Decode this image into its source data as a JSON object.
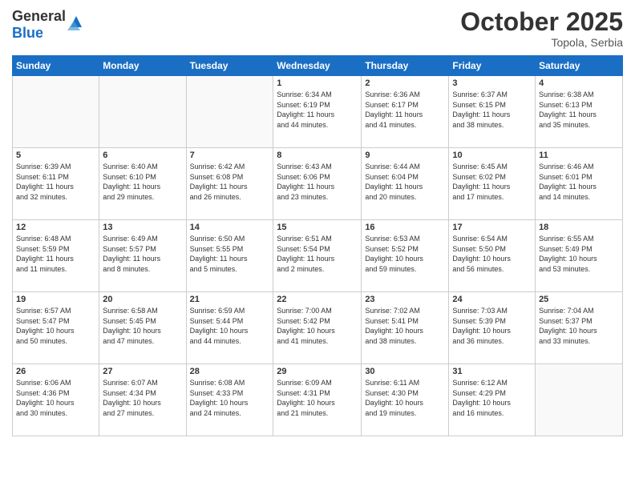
{
  "header": {
    "logo_general": "General",
    "logo_blue": "Blue",
    "month_title": "October 2025",
    "location": "Topola, Serbia"
  },
  "weekdays": [
    "Sunday",
    "Monday",
    "Tuesday",
    "Wednesday",
    "Thursday",
    "Friday",
    "Saturday"
  ],
  "weeks": [
    [
      {
        "day": "",
        "info": ""
      },
      {
        "day": "",
        "info": ""
      },
      {
        "day": "",
        "info": ""
      },
      {
        "day": "1",
        "info": "Sunrise: 6:34 AM\nSunset: 6:19 PM\nDaylight: 11 hours\nand 44 minutes."
      },
      {
        "day": "2",
        "info": "Sunrise: 6:36 AM\nSunset: 6:17 PM\nDaylight: 11 hours\nand 41 minutes."
      },
      {
        "day": "3",
        "info": "Sunrise: 6:37 AM\nSunset: 6:15 PM\nDaylight: 11 hours\nand 38 minutes."
      },
      {
        "day": "4",
        "info": "Sunrise: 6:38 AM\nSunset: 6:13 PM\nDaylight: 11 hours\nand 35 minutes."
      }
    ],
    [
      {
        "day": "5",
        "info": "Sunrise: 6:39 AM\nSunset: 6:11 PM\nDaylight: 11 hours\nand 32 minutes."
      },
      {
        "day": "6",
        "info": "Sunrise: 6:40 AM\nSunset: 6:10 PM\nDaylight: 11 hours\nand 29 minutes."
      },
      {
        "day": "7",
        "info": "Sunrise: 6:42 AM\nSunset: 6:08 PM\nDaylight: 11 hours\nand 26 minutes."
      },
      {
        "day": "8",
        "info": "Sunrise: 6:43 AM\nSunset: 6:06 PM\nDaylight: 11 hours\nand 23 minutes."
      },
      {
        "day": "9",
        "info": "Sunrise: 6:44 AM\nSunset: 6:04 PM\nDaylight: 11 hours\nand 20 minutes."
      },
      {
        "day": "10",
        "info": "Sunrise: 6:45 AM\nSunset: 6:02 PM\nDaylight: 11 hours\nand 17 minutes."
      },
      {
        "day": "11",
        "info": "Sunrise: 6:46 AM\nSunset: 6:01 PM\nDaylight: 11 hours\nand 14 minutes."
      }
    ],
    [
      {
        "day": "12",
        "info": "Sunrise: 6:48 AM\nSunset: 5:59 PM\nDaylight: 11 hours\nand 11 minutes."
      },
      {
        "day": "13",
        "info": "Sunrise: 6:49 AM\nSunset: 5:57 PM\nDaylight: 11 hours\nand 8 minutes."
      },
      {
        "day": "14",
        "info": "Sunrise: 6:50 AM\nSunset: 5:55 PM\nDaylight: 11 hours\nand 5 minutes."
      },
      {
        "day": "15",
        "info": "Sunrise: 6:51 AM\nSunset: 5:54 PM\nDaylight: 11 hours\nand 2 minutes."
      },
      {
        "day": "16",
        "info": "Sunrise: 6:53 AM\nSunset: 5:52 PM\nDaylight: 10 hours\nand 59 minutes."
      },
      {
        "day": "17",
        "info": "Sunrise: 6:54 AM\nSunset: 5:50 PM\nDaylight: 10 hours\nand 56 minutes."
      },
      {
        "day": "18",
        "info": "Sunrise: 6:55 AM\nSunset: 5:49 PM\nDaylight: 10 hours\nand 53 minutes."
      }
    ],
    [
      {
        "day": "19",
        "info": "Sunrise: 6:57 AM\nSunset: 5:47 PM\nDaylight: 10 hours\nand 50 minutes."
      },
      {
        "day": "20",
        "info": "Sunrise: 6:58 AM\nSunset: 5:45 PM\nDaylight: 10 hours\nand 47 minutes."
      },
      {
        "day": "21",
        "info": "Sunrise: 6:59 AM\nSunset: 5:44 PM\nDaylight: 10 hours\nand 44 minutes."
      },
      {
        "day": "22",
        "info": "Sunrise: 7:00 AM\nSunset: 5:42 PM\nDaylight: 10 hours\nand 41 minutes."
      },
      {
        "day": "23",
        "info": "Sunrise: 7:02 AM\nSunset: 5:41 PM\nDaylight: 10 hours\nand 38 minutes."
      },
      {
        "day": "24",
        "info": "Sunrise: 7:03 AM\nSunset: 5:39 PM\nDaylight: 10 hours\nand 36 minutes."
      },
      {
        "day": "25",
        "info": "Sunrise: 7:04 AM\nSunset: 5:37 PM\nDaylight: 10 hours\nand 33 minutes."
      }
    ],
    [
      {
        "day": "26",
        "info": "Sunrise: 6:06 AM\nSunset: 4:36 PM\nDaylight: 10 hours\nand 30 minutes."
      },
      {
        "day": "27",
        "info": "Sunrise: 6:07 AM\nSunset: 4:34 PM\nDaylight: 10 hours\nand 27 minutes."
      },
      {
        "day": "28",
        "info": "Sunrise: 6:08 AM\nSunset: 4:33 PM\nDaylight: 10 hours\nand 24 minutes."
      },
      {
        "day": "29",
        "info": "Sunrise: 6:09 AM\nSunset: 4:31 PM\nDaylight: 10 hours\nand 21 minutes."
      },
      {
        "day": "30",
        "info": "Sunrise: 6:11 AM\nSunset: 4:30 PM\nDaylight: 10 hours\nand 19 minutes."
      },
      {
        "day": "31",
        "info": "Sunrise: 6:12 AM\nSunset: 4:29 PM\nDaylight: 10 hours\nand 16 minutes."
      },
      {
        "day": "",
        "info": ""
      }
    ]
  ]
}
